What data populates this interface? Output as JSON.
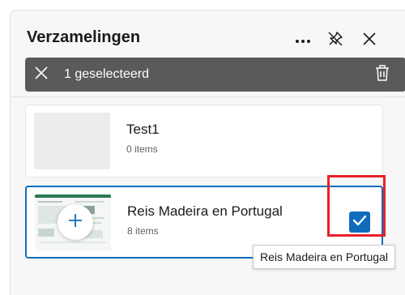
{
  "panel": {
    "title": "Verzamelingen",
    "more_icon": "more-icon",
    "unpin_icon": "unpin-icon",
    "close_icon": "close-icon"
  },
  "selection_bar": {
    "label": "1 geselecteerd",
    "clear_icon": "close-icon",
    "delete_icon": "trash-icon"
  },
  "collections": [
    {
      "name": "Test1",
      "count": "0 items",
      "selected": false
    },
    {
      "name": "Reis Madeira en Portugal",
      "count": "8 items",
      "selected": true
    }
  ],
  "tooltip": "Reis Madeira en Portugal",
  "colors": {
    "accent": "#0f6cbd",
    "selection_bar": "#5a5a5a",
    "highlight_box": "#e8202a"
  }
}
